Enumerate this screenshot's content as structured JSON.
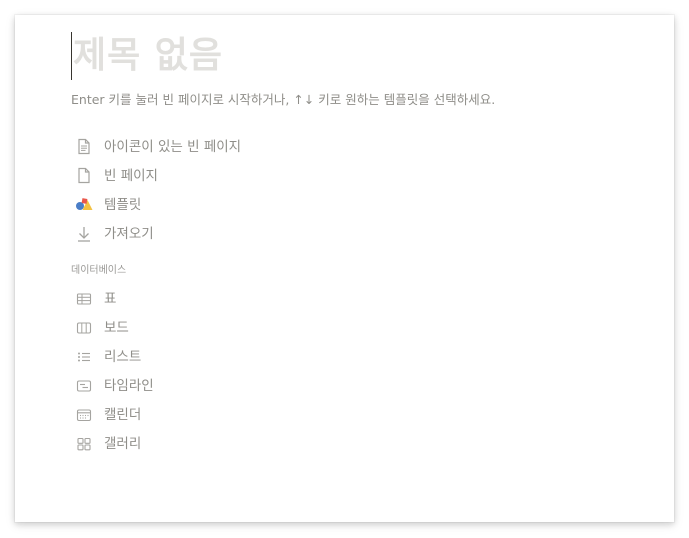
{
  "title": {
    "placeholder": "제목 없음"
  },
  "hint": "Enter 키를 눌러 빈 페이지로 시작하거나, ↑↓ 키로 원하는 템플릿을 선택하세요.",
  "options": [
    {
      "label": "아이콘이 있는 빈 페이지",
      "icon": "document-lines-icon"
    },
    {
      "label": "빈 페이지",
      "icon": "document-icon"
    },
    {
      "label": "템플릿",
      "icon": "templates-shapes-icon"
    },
    {
      "label": "가져오기",
      "icon": "download-arrow-icon"
    }
  ],
  "database": {
    "section_label": "데이터베이스",
    "items": [
      {
        "label": "표",
        "icon": "table-icon"
      },
      {
        "label": "보드",
        "icon": "board-icon"
      },
      {
        "label": "리스트",
        "icon": "list-icon"
      },
      {
        "label": "타임라인",
        "icon": "timeline-icon"
      },
      {
        "label": "캘린더",
        "icon": "calendar-icon"
      },
      {
        "label": "갤러리",
        "icon": "gallery-icon"
      }
    ]
  },
  "colors": {
    "placeholder_text": "#e1e0dd",
    "muted_text": "#8f8e89",
    "icon_gray": "#a5a4a0",
    "template_red": "#e9584c",
    "template_blue": "#4a7ec7",
    "template_yellow": "#f3c244"
  }
}
